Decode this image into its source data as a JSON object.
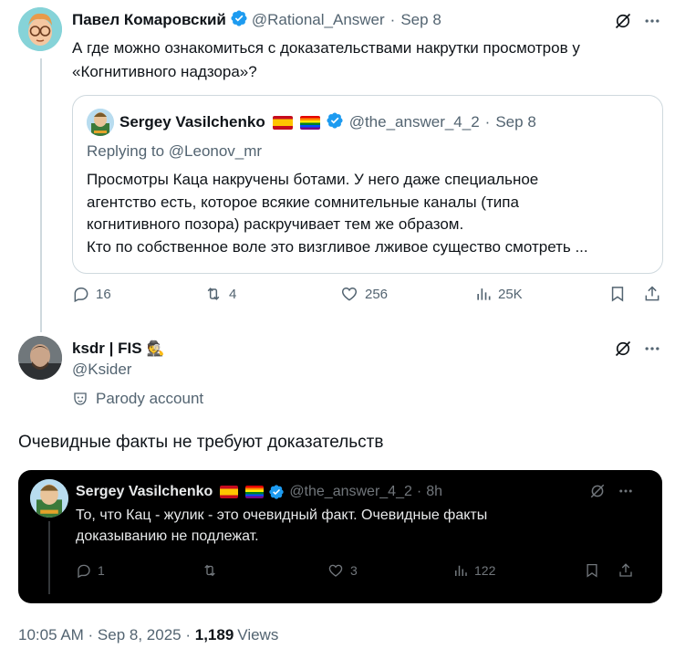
{
  "tweet1": {
    "author_name": "Павел Комаровский",
    "handle": "@Rational_Answer",
    "separator": "·",
    "date": "Sep 8",
    "text_line1": "А где можно ознакомиться с доказательствами накрутки просмотров у",
    "text_line2": "«Когнитивного надзора»?",
    "quote": {
      "author_name": "Sergey Vasilchenko",
      "handle": "@the_answer_4_2",
      "separator": "·",
      "date": "Sep 8",
      "replying_to": "Replying to @Leonov_mr",
      "text_line1": "Просмотры Каца накручены ботами. У него даже специальное",
      "text_line2": "агентство есть, которое всякие сомнительные каналы (типа",
      "text_line3": "когнитивного позора) раскручивает тем же образом.",
      "text_line4": "Кто по собственное воле это визгливое лживое существо смотреть ..."
    },
    "actions": {
      "replies": "16",
      "reposts": "4",
      "likes": "256",
      "views": "25K"
    }
  },
  "tweet2": {
    "author_name": "ksdr | FIS",
    "author_emoji": "🕵",
    "handle": "@Ksider",
    "parody_label": "Parody account",
    "text": "Очевидные факты не требуют доказательств",
    "embedded_screenshot": {
      "author_name": "Sergey Vasilchenko",
      "handle": "@the_answer_4_2",
      "separator": "·",
      "time": "8h",
      "text_line1": "То, что Кац - жулик - это очевидный факт. Очевидные факты",
      "text_line2": "доказыванию не подлежат.",
      "replies": "1",
      "likes": "3",
      "views": "122"
    },
    "timestamp": "10:05 AM · Sep 8, 2025 · ",
    "view_count": "1,189",
    "views_label": "Views"
  },
  "colors": {
    "verified_blue": "#1d9bf0",
    "muted_text": "#536471",
    "border": "#cfd9de",
    "dark_card_bg": "#000000"
  }
}
